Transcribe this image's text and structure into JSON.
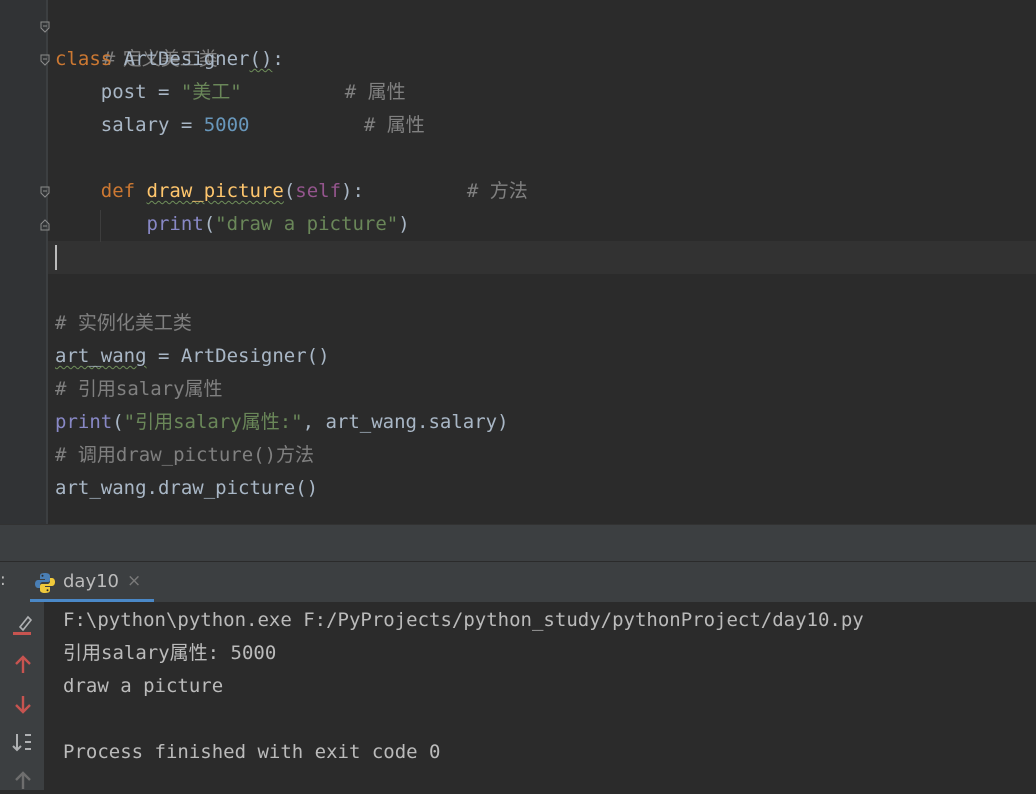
{
  "editor": {
    "lines": {
      "l1": {
        "comment": "# 定义美工类"
      },
      "l2": {
        "kw": "class",
        "name": "ArtDesigner",
        "paren": "()",
        "colon": ":"
      },
      "l3": {
        "lhs": "    post = ",
        "str": "\"美工\"",
        "pad": "         ",
        "comment": "# 属性"
      },
      "l4": {
        "lhs": "    salary = ",
        "num": "5000",
        "pad": "          ",
        "comment": "# 属性"
      },
      "l6": {
        "indent": "    ",
        "kw": "def",
        "sp": " ",
        "fn": "draw_picture",
        "open": "(",
        "self": "self",
        "close": "):",
        "pad": "         ",
        "comment": "# 方法"
      },
      "l7": {
        "indent": "        ",
        "builtin": "print",
        "open": "(",
        "str": "\"draw a picture\"",
        "close": ")"
      },
      "l10": {
        "comment": "# 实例化美工类"
      },
      "l11": {
        "var": "art_wang",
        "rest": " = ArtDesigner()"
      },
      "l12": {
        "comment": "# 引用salary属性"
      },
      "l13": {
        "builtin": "print",
        "open": "(",
        "str": "\"引用salary属性:\"",
        "rest": ", art_wang.salary)"
      },
      "l14": {
        "comment": "# 调用draw_picture()方法"
      },
      "l15": {
        "code": "art_wang.draw_picture()"
      }
    }
  },
  "run": {
    "panel_prefix": ":",
    "tab_label": "day10",
    "tab_close": "×",
    "toolbar_icons": [
      "clear-all-icon",
      "up-arrow-icon",
      "down-arrow-icon",
      "soft-wrap-sort-icon",
      "up-arrow-icon"
    ],
    "console_lines": [
      "F:\\python\\python.exe F:/PyProjects/python_study/pythonProject/day10.py",
      "引用salary属性: 5000",
      "draw a picture",
      "",
      "Process finished with exit code 0"
    ]
  },
  "colors": {
    "keyword": "#cc7832",
    "string": "#6a8759",
    "number": "#6897bb",
    "comment": "#808080",
    "builtin": "#8888c6",
    "self": "#94558d",
    "function": "#ffc66d",
    "run_arrow": "#c75450"
  }
}
